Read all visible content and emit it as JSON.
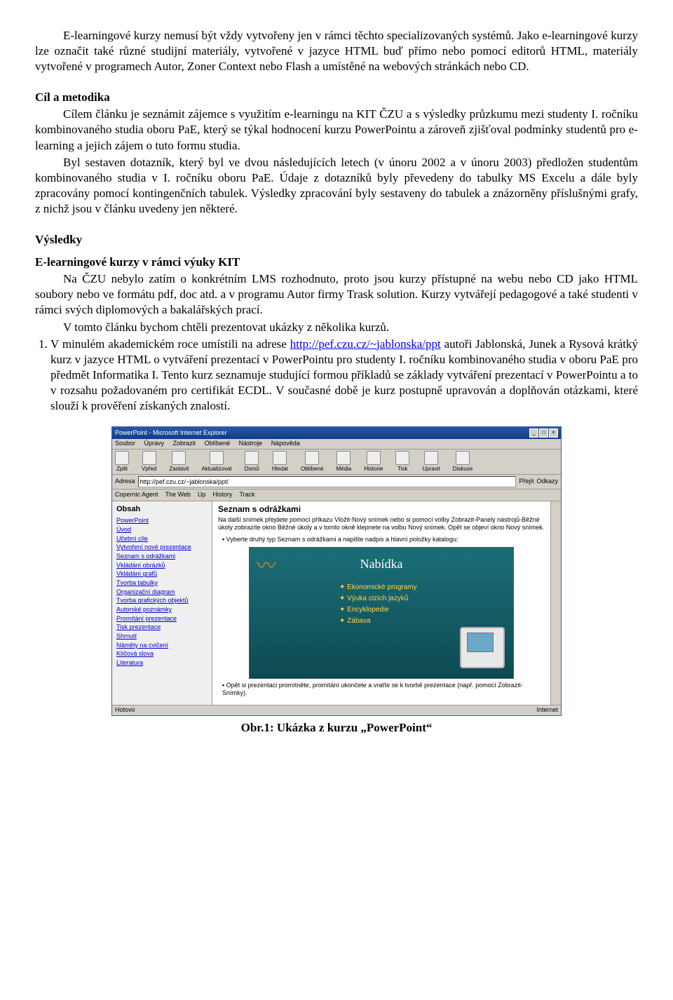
{
  "para1": "E-learningové kurzy nemusí být vždy vytvořeny jen v rámci těchto specializovaných systémů. Jako e-learningové kurzy lze označit také různé studijní materiály, vytvořené v jazyce HTML buď přímo nebo pomocí editorů HTML, materiály vytvořené v programech Autor, Zoner Context nebo Flash a umístěné na webových stránkách nebo CD.",
  "h_cil": "Cíl a metodika",
  "cil_p1": "Cílem článku je seznámit zájemce s využitím e-learningu na KIT ČZU a s výsledky průzkumu mezi studenty I. ročníku kombinovaného studia oboru PaE, který se týkal hodnocení kurzu PowerPointu a zároveň zjišťoval podmínky studentů pro e-learning a jejich zájem o tuto formu studia.",
  "cil_p2": "Byl sestaven dotazník, který byl ve dvou následujících letech (v únoru 2002 a v únoru 2003) předložen studentům kombinovaného studia v I. ročníku oboru PaE. Údaje z dotazníků byly převedeny do tabulky  MS Excelu a dále byly zpracovány pomocí kontingenčních tabulek. Výsledky zpracování byly sestaveny do tabulek a znázorněny příslušnými grafy, z nichž jsou v článku uvedeny jen některé.",
  "h_vysl": "Výsledky",
  "h_sub": "E-learningové kurzy v rámci výuky KIT",
  "vysl_p1": "Na ČZU nebylo zatím o konkrétním LMS rozhodnuto, proto jsou kurzy přístupné na webu nebo CD jako HTML soubory nebo ve formátu pdf, doc atd. a v programu Autor firmy Trask solution. Kurzy vytvářejí pedagogové a také studenti v rámci svých diplomových a bakalářských prací.",
  "vysl_p2": "V tomto článku bychom chtěli prezentovat ukázky z několika kurzů.",
  "list1_pre": "V minulém akademickém roce umístili na adrese ",
  "list1_link": "http://pef.czu.cz/~jablonska/ppt",
  "list1_post": " autoři Jablonská, Junek a Rysová krátký kurz v jazyce HTML o vytváření prezentací v PowerPointu pro studenty I. ročníku kombinovaného studia v oboru PaE pro předmět Informatika I. Tento kurz seznamuje studující formou příkladů se základy vytváření prezentací v PowerPointu a to v rozsahu požadovaném pro certifikát ECDL. V současné době je kurz postupně upravován a doplňován otázkami, které slouží k prověření získaných znalostí.",
  "browser": {
    "title": "PowerPoint - Microsoft Internet Explorer",
    "menu": [
      "Soubor",
      "Úpravy",
      "Zobrazit",
      "Oblíbené",
      "Nástroje",
      "Nápověda"
    ],
    "tools": [
      "Zpět",
      "Vpřed",
      "Zastavit",
      "Aktualizovat",
      "Domů",
      "Hledat",
      "Oblíbené",
      "Média",
      "Historie",
      "Tisk",
      "Upravit",
      "Diskuse"
    ],
    "addr_label": "Adresa",
    "addr": "http://pef.czu.cz/~jablonska/ppt/",
    "go": "Přejít",
    "links": "Odkazy",
    "copernic": [
      "Copernic Agent",
      "The Web",
      "Up",
      "History",
      "Track"
    ],
    "sidebar_title": "Obsah",
    "sidebar_items": [
      "PowerPoint",
      "Úvod",
      "Učební cíle",
      "Vytvoření nové prezentace",
      "Seznam s odrážkami",
      "Vkládání obrázků",
      "Vkládání grafů",
      "Tvorba tabulky",
      "Organizační diagram",
      "Tvorba grafických objektů",
      "Autorské poznámky",
      "Promítání prezentace",
      "Tisk prezentace",
      "Shrnutí",
      "Náměty na cvičení",
      "Klíčová slova",
      "Literatura"
    ],
    "main_title": "Seznam s odrážkami",
    "main_desc_1": "Na další snímek přejdete pomocí příkazu Vložit-Nový snímek nebo si pomocí volby Zobrazit-Panely nástrojů-Běžné úkoly zobrazíte okno Běžné úkoly a v tomto okně klepnete na volbu Nový snímek. Opět se objeví okno Nový snímek.",
    "bullet1": "Vyberte druhý typ Seznam s odrážkami a napište nadpis a hlavní položky katalogu:",
    "slide_title": "Nabídka",
    "slide_items": [
      "Ekonomické programy",
      "Výuka cizích jazyků",
      "Encyklopedie",
      "Zábava"
    ],
    "bullet2": "Opět si prezentaci promítněte, promítání ukončete a vraťte se k tvorbě prezentace (např. pomocí Zobrazit-Snímky).",
    "status_left": "Hotovo",
    "status_right": "Internet"
  },
  "caption": "Obr.1: Ukázka z kurzu „PowerPoint“"
}
